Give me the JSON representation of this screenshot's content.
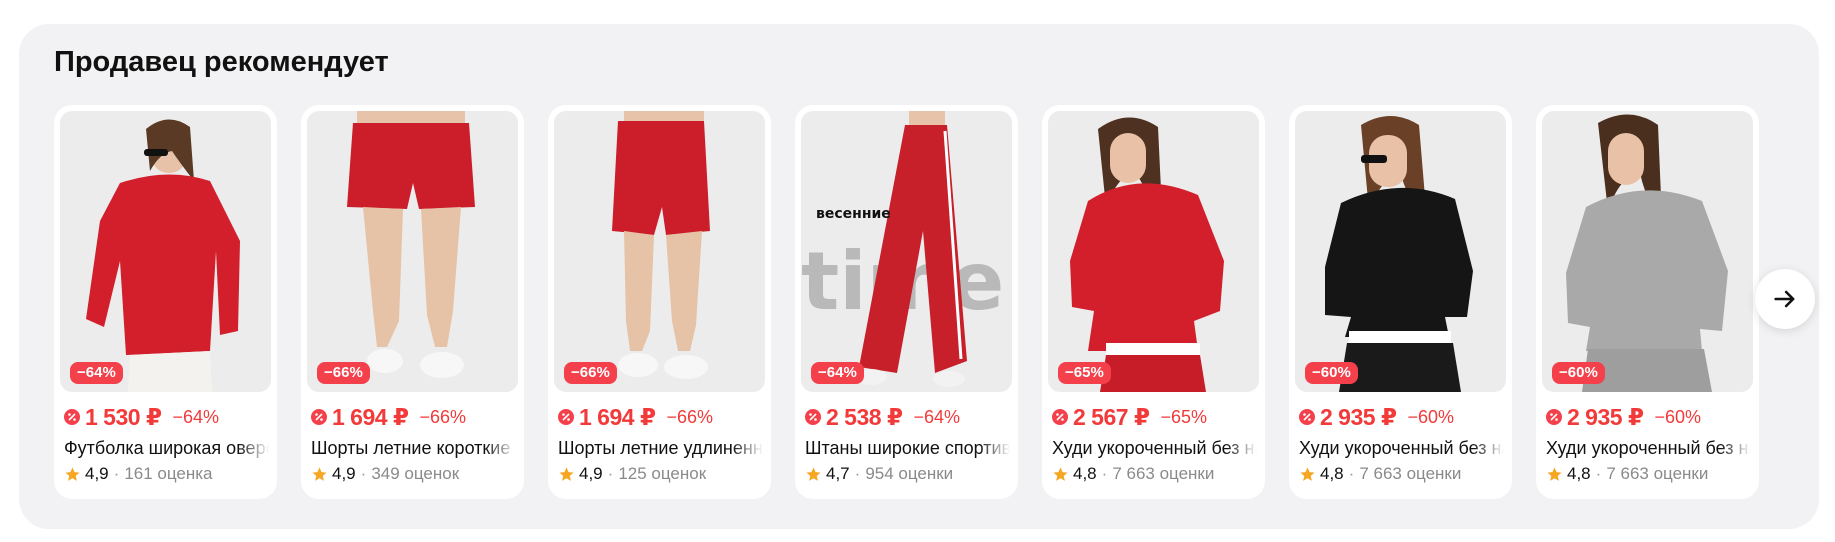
{
  "section": {
    "title": "Продавец рекомендует"
  },
  "colors": {
    "discount_red": "#f3404b",
    "star": "#f5a623",
    "panel_bg": "#f2f2f4"
  },
  "products": [
    {
      "discount_badge": "−64%",
      "price": "1 530 ₽",
      "discount": "−64%",
      "name": "Футболка широкая оверсайз",
      "rating": "4,9",
      "reviews": "161 оценка",
      "image": "woman-red-oversized-tshirt"
    },
    {
      "discount_badge": "−66%",
      "price": "1 694 ₽",
      "discount": "−66%",
      "name": "Шорты летние короткие",
      "rating": "4,9",
      "reviews": "349 оценок",
      "image": "red-short-shorts"
    },
    {
      "discount_badge": "−66%",
      "price": "1 694 ₽",
      "discount": "−66%",
      "name": "Шорты летние удлиненные",
      "rating": "4,9",
      "reviews": "125 оценок",
      "image": "red-long-shorts"
    },
    {
      "discount_badge": "−64%",
      "price": "2 538 ₽",
      "discount": "−64%",
      "name": "Штаны широкие спортивные",
      "rating": "4,7",
      "reviews": "954 оценки",
      "image": "red-wide-pants",
      "image_text": "весенние"
    },
    {
      "discount_badge": "−65%",
      "price": "2 567 ₽",
      "discount": "−65%",
      "name": "Худи укороченный без начеса",
      "rating": "4,8",
      "reviews": "7 663 оценки",
      "image": "woman-red-hoodie"
    },
    {
      "discount_badge": "−60%",
      "price": "2 935 ₽",
      "discount": "−60%",
      "name": "Худи укороченный без начеса",
      "rating": "4,8",
      "reviews": "7 663 оценки",
      "image": "woman-black-hoodie"
    },
    {
      "discount_badge": "−60%",
      "price": "2 935 ₽",
      "discount": "−60%",
      "name": "Худи укороченный без начеса",
      "rating": "4,8",
      "reviews": "7 663 оценки",
      "image": "woman-grey-hoodie"
    }
  ],
  "navigation": {
    "next_icon": "arrow-right-icon"
  }
}
